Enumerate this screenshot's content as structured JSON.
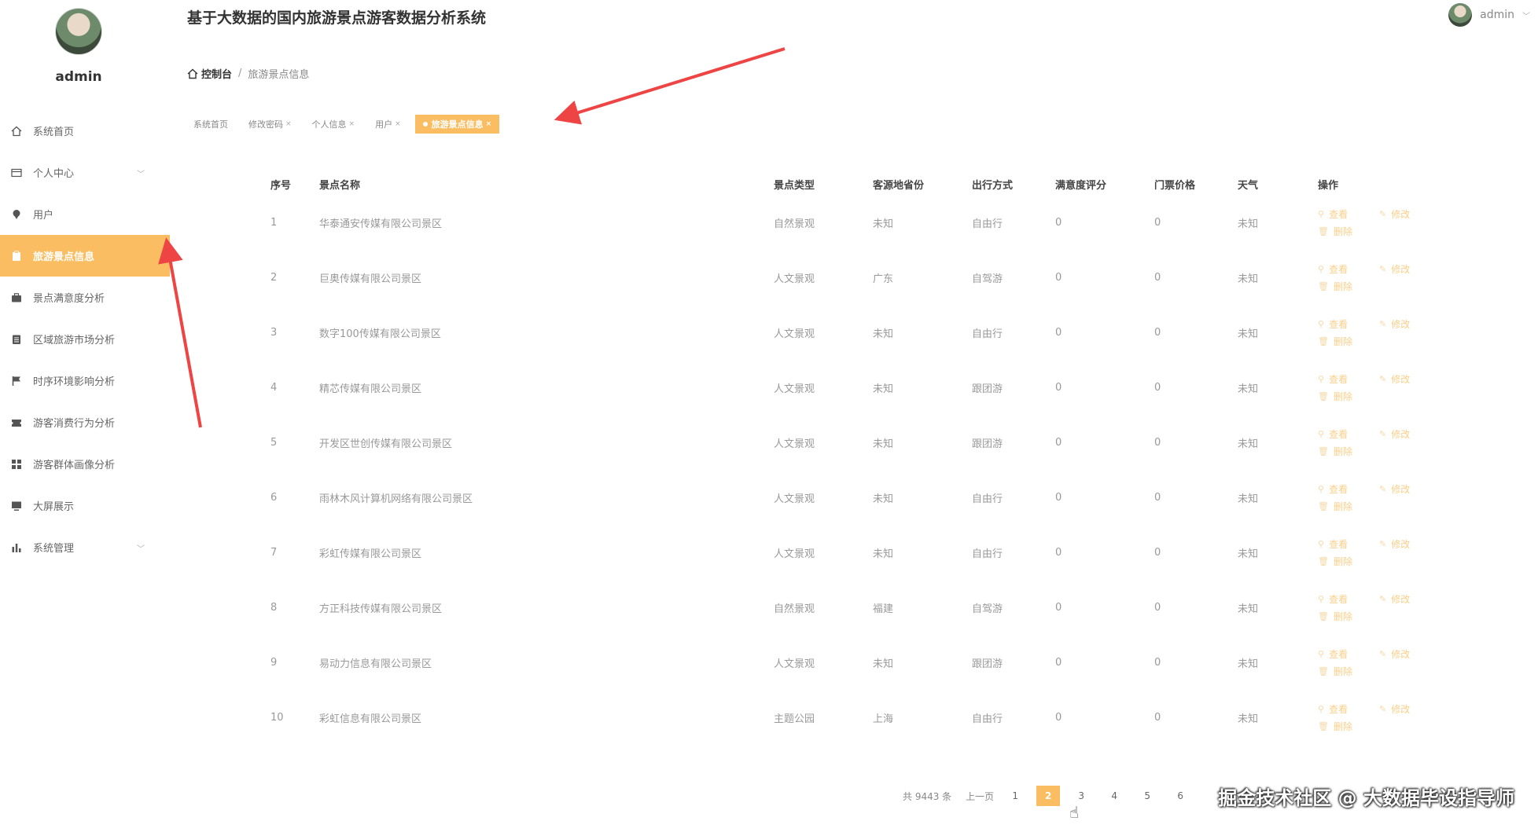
{
  "app": {
    "title": "基于大数据的国内旅游景点游客数据分析系统"
  },
  "header": {
    "user": "admin"
  },
  "sidebar": {
    "user": "admin",
    "items": [
      {
        "label": "系统首页",
        "icon": "home-icon"
      },
      {
        "label": "个人中心",
        "icon": "card-icon"
      },
      {
        "label": "用户",
        "icon": "pin-icon"
      },
      {
        "label": "旅游景点信息",
        "icon": "clipboard-icon"
      },
      {
        "label": "景点满意度分析",
        "icon": "briefcase-icon"
      },
      {
        "label": "区域旅游市场分析",
        "icon": "list-icon"
      },
      {
        "label": "时序环境影响分析",
        "icon": "flag-icon"
      },
      {
        "label": "游客消费行为分析",
        "icon": "ticket-icon"
      },
      {
        "label": "游客群体画像分析",
        "icon": "grid-icon"
      },
      {
        "label": "大屏展示",
        "icon": "monitor-icon"
      },
      {
        "label": "系统管理",
        "icon": "chart-icon"
      }
    ]
  },
  "breadcrumb": {
    "home": "控制台",
    "separator": "/",
    "current": "旅游景点信息"
  },
  "tags": [
    "系统首页",
    "修改密码",
    "个人信息",
    "用户",
    "旅游景点信息"
  ],
  "table": {
    "headers": [
      "序号",
      "景点名称",
      "景点类型",
      "客源地省份",
      "出行方式",
      "满意度评分",
      "门票价格",
      "天气",
      "操作"
    ],
    "rows": [
      [
        "1",
        "华泰通安传媒有限公司景区",
        "自然景观",
        "未知",
        "自由行",
        "0",
        "0",
        "未知"
      ],
      [
        "2",
        "巨奥传媒有限公司景区",
        "人文景观",
        "广东",
        "自驾游",
        "0",
        "0",
        "未知"
      ],
      [
        "3",
        "数字100传媒有限公司景区",
        "人文景观",
        "未知",
        "自由行",
        "0",
        "0",
        "未知"
      ],
      [
        "4",
        "精芯传媒有限公司景区",
        "人文景观",
        "未知",
        "跟团游",
        "0",
        "0",
        "未知"
      ],
      [
        "5",
        "开发区世创传媒有限公司景区",
        "人文景观",
        "未知",
        "跟团游",
        "0",
        "0",
        "未知"
      ],
      [
        "6",
        "雨林木风计算机网络有限公司景区",
        "人文景观",
        "未知",
        "自由行",
        "0",
        "0",
        "未知"
      ],
      [
        "7",
        "彩虹传媒有限公司景区",
        "人文景观",
        "未知",
        "自由行",
        "0",
        "0",
        "未知"
      ],
      [
        "8",
        "方正科技传媒有限公司景区",
        "自然景观",
        "福建",
        "自驾游",
        "0",
        "0",
        "未知"
      ],
      [
        "9",
        "易动力信息有限公司景区",
        "人文景观",
        "未知",
        "跟团游",
        "0",
        "0",
        "未知"
      ],
      [
        "10",
        "彩虹信息有限公司景区",
        "主题公园",
        "上海",
        "自由行",
        "0",
        "0",
        "未知"
      ]
    ],
    "actions": {
      "view": "查看",
      "edit": "修改",
      "delete": "删除"
    }
  },
  "pagination": {
    "total": "共 9443 条",
    "prev": "上一页",
    "pages": [
      "1",
      "2",
      "3",
      "4",
      "5",
      "6"
    ],
    "current": "2"
  },
  "watermark": "掘金技术社区 @ 大数据毕设指导师",
  "colors": {
    "accent": "#fbbd61",
    "annotation": "#ef4444"
  }
}
